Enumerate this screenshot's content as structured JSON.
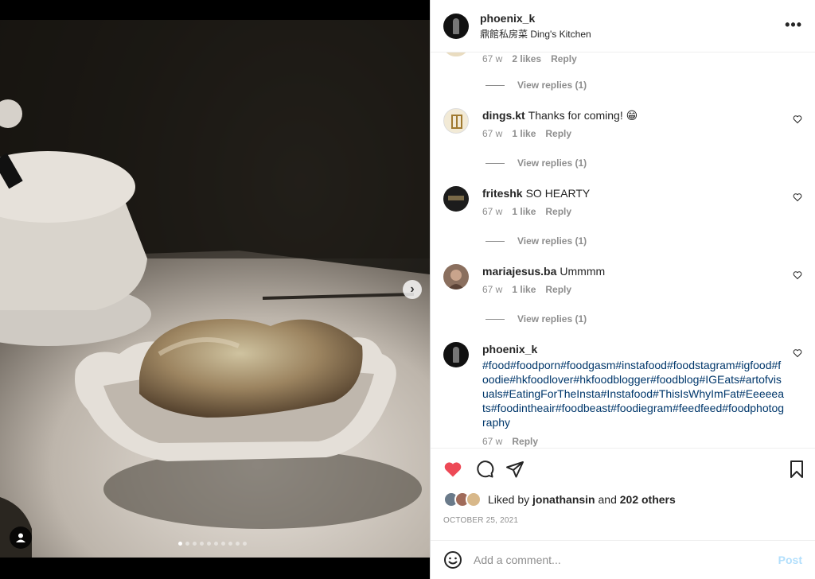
{
  "header": {
    "username": "phoenix_k",
    "location": "鼎館私房菜 Ding's Kitchen",
    "more_icon": "more-horizontal-icon"
  },
  "photo": {
    "total_slides": 10,
    "active_slide": 1
  },
  "comments": {
    "first_partial": {
      "age": "67 w",
      "likes": "2 likes",
      "reply": "Reply",
      "view_replies": "View replies (1)"
    },
    "items": [
      {
        "user": "dings.kt",
        "text": "Thanks for coming! 😁",
        "age": "67 w",
        "likes": "1 like",
        "reply": "Reply",
        "view_replies": "View replies (1)"
      },
      {
        "user": "friteshk",
        "text": "SO HEARTY",
        "age": "67 w",
        "likes": "1 like",
        "reply": "Reply",
        "view_replies": "View replies (1)"
      },
      {
        "user": "mariajesus.ba",
        "text": "Ummmm",
        "age": "67 w",
        "likes": "1 like",
        "reply": "Reply",
        "view_replies": "View replies (1)"
      }
    ],
    "caption": {
      "user": "phoenix_k",
      "hashtags": "#food#foodporn#foodgasm#instafood#foodstagram#igfood#foodie#hkfoodlover#hkfoodblogger#foodblog#IGEats#artofvisuals#EatingForTheInsta#Instafood#ThisIsWhyImFat#Eeeeeats#foodintheair#foodbeast#foodiegram#feedfeed#foodphotography",
      "age": "67 w",
      "reply": "Reply"
    }
  },
  "likes": {
    "prefix": "Liked by",
    "user": "jonathansin",
    "and": "and",
    "others": "202 others"
  },
  "date": "OCTOBER 25, 2021",
  "add_comment": {
    "placeholder": "Add a comment...",
    "post_label": "Post"
  },
  "colors": {
    "heart_red": "#ed4956",
    "hashtag_blue": "#00376b",
    "post_disabled": "#b2dffc"
  }
}
